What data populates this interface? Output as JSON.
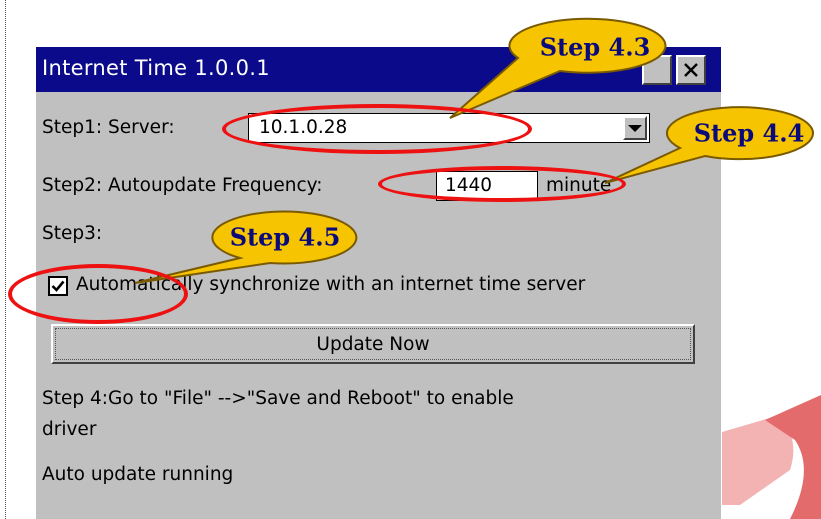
{
  "window": {
    "title": "Internet Time 1.0.0.1",
    "buttons": [
      "ok-button",
      "close-button"
    ]
  },
  "form": {
    "step1_label": "Step1: Server:",
    "server_value": "10.1.0.28",
    "step2_label": "Step2: Autoupdate Frequency:",
    "frequency_value": "1440",
    "frequency_unit": "minute",
    "step3_label": "Step3:",
    "auto_sync_label": "Automatically synchronize with an internet time server",
    "auto_sync_checked": true,
    "update_button": "Update Now",
    "step4_text_line1": "Step 4:Go to \"File\" -->\"Save and Reboot\" to enable",
    "step4_text_line2": "driver",
    "status_text": "Auto update running"
  },
  "annotations": {
    "callout_1": "Step 4.3",
    "callout_2": "Step 4.4",
    "callout_3": "Step 4.5"
  },
  "colors": {
    "titlebar": "#0a0a8a",
    "window_bg": "#c0c0c0",
    "callout_fill": "#f6c400",
    "highlight_ellipse": "#ee1111",
    "callout_text": "#0a0a7a"
  }
}
